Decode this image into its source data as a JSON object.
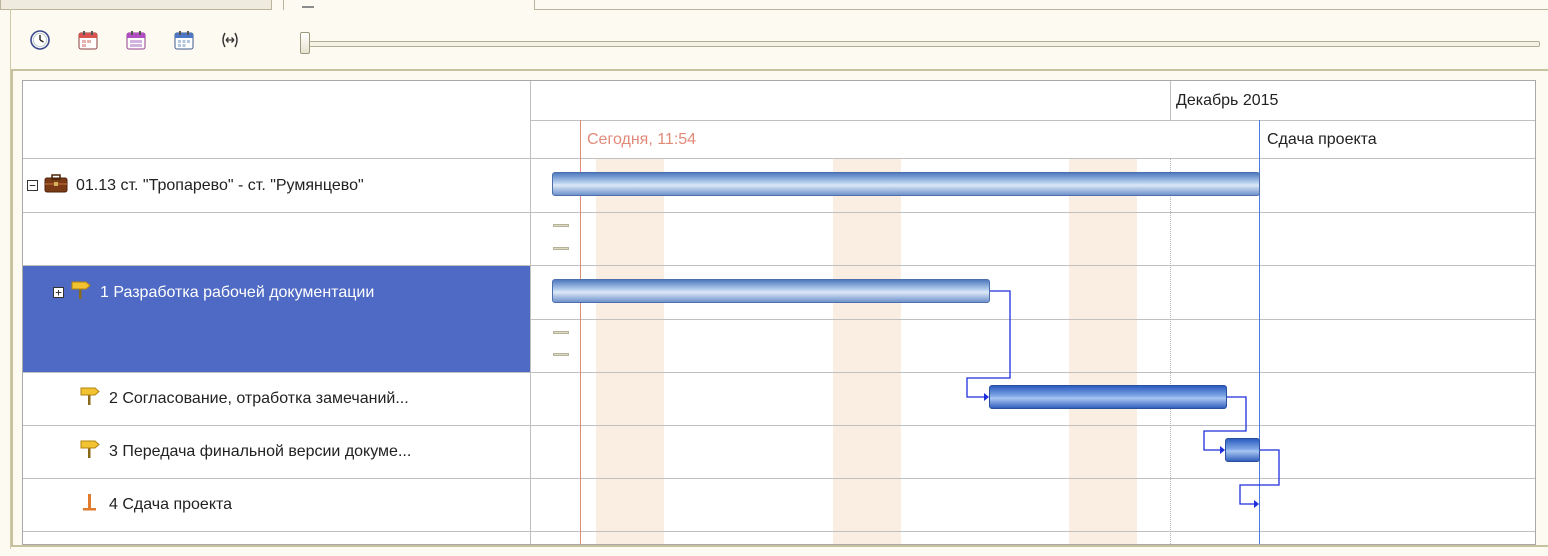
{
  "toolbar": {
    "buttons": [
      {
        "name": "clock-icon",
        "title": "clock"
      },
      {
        "name": "calendar-day-icon",
        "title": "day"
      },
      {
        "name": "calendar-week-icon",
        "title": "week"
      },
      {
        "name": "calendar-month-icon",
        "title": "month"
      },
      {
        "name": "fit-width-icon",
        "title": "fit"
      }
    ],
    "scale_position": 0
  },
  "header": {
    "month": "Декабрь 2015",
    "today_marker": "Сегодня, 11:54",
    "milestone_marker": "Сдача проекта"
  },
  "tasks": [
    {
      "id": "t0",
      "label": "01.13 ст. \"Тропарево\" - ст. \"Румянцево\"",
      "expander": "−",
      "icon": "briefcase-icon"
    },
    {
      "id": "t1",
      "label": "1 Разработка рабочей документации",
      "expander": "+",
      "icon": "signpost-icon",
      "selected": true
    },
    {
      "id": "t2",
      "label": "2 Согласование,  отработка замечаний...",
      "icon": "signpost-icon"
    },
    {
      "id": "t3",
      "label": "3 Передача финальной версии докуме...",
      "icon": "signpost-icon"
    },
    {
      "id": "t4",
      "label": "4 Сдача проекта",
      "icon": "milestone-icon"
    }
  ],
  "colors": {
    "selection": "#4f6ac4",
    "today_line": "#e08a78",
    "milestone_line": "#4a7be0",
    "link": "#1f2fdc",
    "weekend": "#faede2"
  }
}
